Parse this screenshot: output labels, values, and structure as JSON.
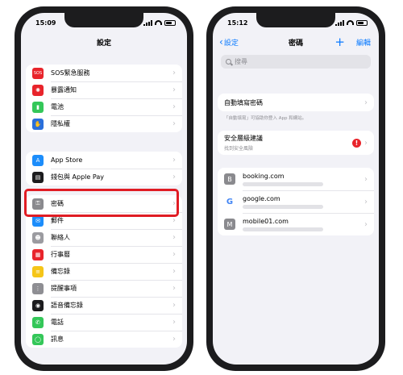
{
  "left": {
    "status_time": "15:09",
    "nav_title": "設定",
    "group1": [
      {
        "label": "SOS緊急服務",
        "icon": "sos-icon",
        "icon_text": "SOS",
        "color": "#e8242b"
      },
      {
        "label": "暴露通知",
        "icon": "exposure-notification-icon",
        "icon_text": "✺",
        "color": "#e8242b"
      },
      {
        "label": "電池",
        "icon": "battery-icon",
        "icon_text": "▮",
        "color": "#34c759"
      },
      {
        "label": "隱私權",
        "icon": "privacy-hand-icon",
        "icon_text": "✋",
        "color": "#2a6fdb"
      }
    ],
    "group2": [
      {
        "label": "App Store",
        "icon": "app-store-icon",
        "icon_text": "A",
        "color": "#1c8dfb"
      },
      {
        "label": "錢包與 Apple Pay",
        "icon": "wallet-icon",
        "icon_text": "▤",
        "color": "#1c1c1e"
      }
    ],
    "group3": [
      {
        "label": "密碼",
        "icon": "key-icon",
        "icon_text": "⚿",
        "color": "#8a8a8e"
      },
      {
        "label": "郵件",
        "icon": "mail-icon",
        "icon_text": "✉",
        "color": "#1c8dfb"
      },
      {
        "label": "聯絡人",
        "icon": "contacts-icon",
        "icon_text": "☻",
        "color": "#9b9ba0"
      },
      {
        "label": "行事曆",
        "icon": "calendar-icon",
        "icon_text": "▦",
        "color": "#e8242b"
      },
      {
        "label": "備忘錄",
        "icon": "notes-icon",
        "icon_text": "≡",
        "color": "#f5c518"
      },
      {
        "label": "提醒事項",
        "icon": "reminders-icon",
        "icon_text": "⋮",
        "color": "#8e8e93"
      },
      {
        "label": "語音備忘錄",
        "icon": "voice-memos-icon",
        "icon_text": "◉",
        "color": "#1c1c1e"
      },
      {
        "label": "電話",
        "icon": "phone-icon",
        "icon_text": "✆",
        "color": "#34c759"
      },
      {
        "label": "訊息",
        "icon": "messages-icon",
        "icon_text": "◯",
        "color": "#34c759"
      }
    ]
  },
  "right": {
    "status_time": "15:12",
    "nav_back": "設定",
    "nav_title": "密碼",
    "nav_add": "+",
    "nav_edit": "編輯",
    "search_placeholder": "搜尋",
    "autofill_label": "自動填寫密碼",
    "autofill_footnote": "「自動填寫」可協助你登入 App 和網站。",
    "security_title": "安全層級建議",
    "security_subtitle": "找到安全風險",
    "security_badge": "!",
    "sites": [
      {
        "name": "booking.com",
        "icon": "booking-site-icon",
        "icon_text": "B"
      },
      {
        "name": "google.com",
        "icon": "google-site-icon",
        "icon_text": "G"
      },
      {
        "name": "mobile01.com",
        "icon": "mobile01-site-icon",
        "icon_text": "M"
      }
    ]
  }
}
